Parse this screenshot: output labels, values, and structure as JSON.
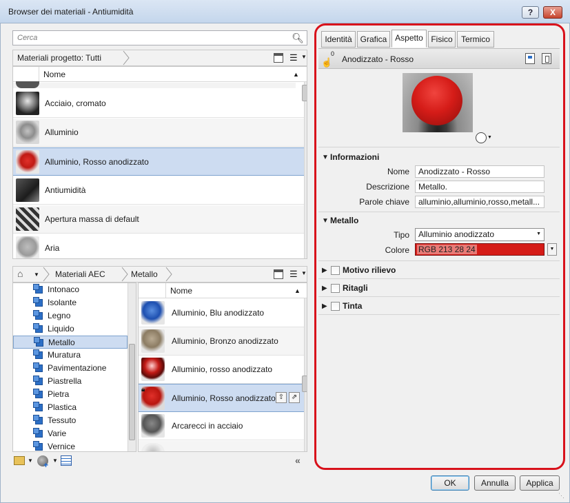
{
  "window": {
    "title": "Browser dei materiali - Antiumidità",
    "help_label": "?",
    "close_label": "X"
  },
  "search": {
    "placeholder": "Cerca"
  },
  "project_bar": {
    "label": "Materiali progetto: Tutti"
  },
  "top_list": {
    "column_header": "Nome",
    "items": [
      {
        "label": "Acciaio, cromato"
      },
      {
        "label": "Alluminio"
      },
      {
        "label": "Alluminio, Rosso anodizzato"
      },
      {
        "label": "Antiumidità"
      },
      {
        "label": "Apertura massa di default"
      },
      {
        "label": "Aria"
      }
    ]
  },
  "library_bar": {
    "crumb1": "Materiali AEC",
    "crumb2": "Metallo"
  },
  "categories": [
    "Intonaco",
    "Isolante",
    "Legno",
    "Liquido",
    "Metallo",
    "Muratura",
    "Pavimentazione",
    "Piastrella",
    "Pietra",
    "Plastica",
    "Tessuto",
    "Varie",
    "Vernice"
  ],
  "library_list": {
    "column_header": "Nome",
    "items": [
      {
        "label": "Alluminio, Blu anodizzato"
      },
      {
        "label": "Alluminio, Bronzo anodizzato"
      },
      {
        "label": "Alluminio, rosso anodizzato"
      },
      {
        "label": "Alluminio, Rosso anodizzato"
      },
      {
        "label": "Arcarecci in acciaio"
      }
    ]
  },
  "tabs": [
    "Identità",
    "Grafica",
    "Aspetto",
    "Fisico",
    "Termico"
  ],
  "asset": {
    "count": "0",
    "name": "Anodizzato - Rosso"
  },
  "info": {
    "header": "Informazioni",
    "name_label": "Nome",
    "name_value": "Anodizzato - Rosso",
    "desc_label": "Descrizione",
    "desc_value": "Metallo.",
    "keywords_label": "Parole chiave",
    "keywords_value": "alluminio,alluminio,rosso,metall..."
  },
  "metal": {
    "header": "Metallo",
    "type_label": "Tipo",
    "type_value": "Alluminio anodizzato",
    "color_label": "Colore",
    "color_value": "RGB 213 28 24",
    "color_hex": "#d51c18"
  },
  "sections": {
    "relief": "Motivo rilievo",
    "cutouts": "Ritagli",
    "tint": "Tinta"
  },
  "buttons": {
    "ok": "OK",
    "cancel": "Annulla",
    "apply": "Applica"
  },
  "colors": {
    "accent_red": "#d8111b",
    "selection": "#cddcf1"
  }
}
